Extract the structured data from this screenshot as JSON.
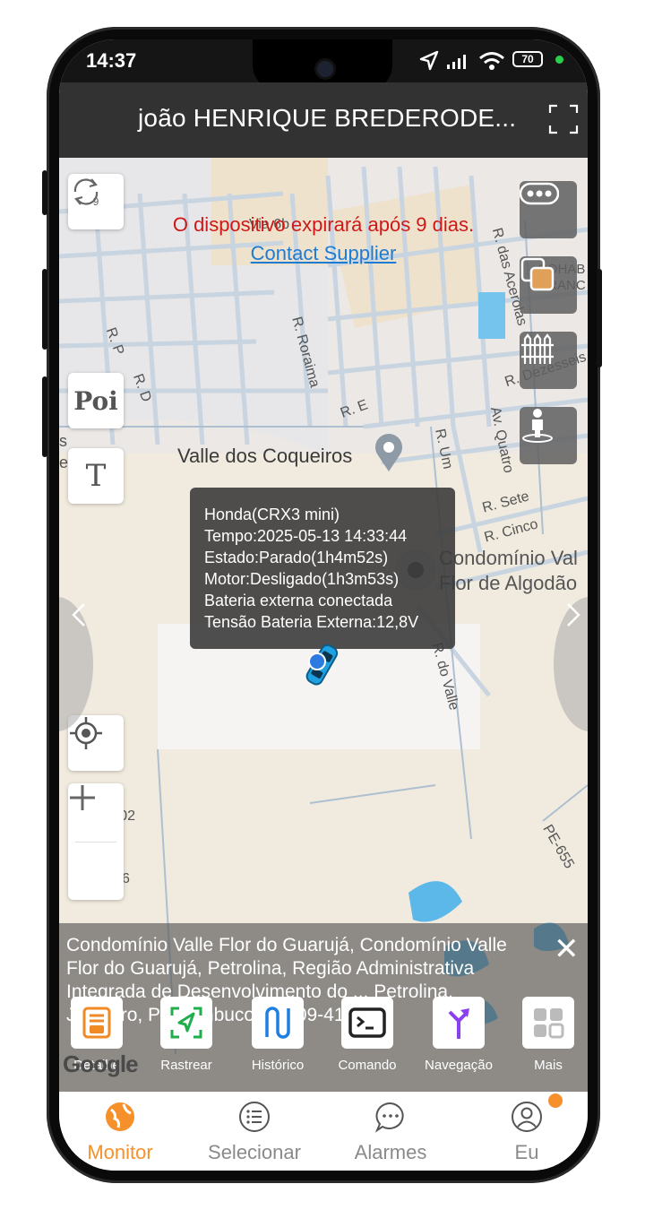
{
  "status_bar": {
    "time": "14:37",
    "battery": "70"
  },
  "app_bar": {
    "title": "joão HENRIQUE BREDERODE..."
  },
  "map": {
    "expiry_notice": "O dispositivo expirará após 9 dias.",
    "contact_link": "Contact Supplier",
    "refresh_count": "9",
    "poi_label": "Poi",
    "text_tool_label": "T",
    "place_labels": {
      "via_6b": "Via 6b",
      "r_p": "R. P",
      "r_d": "R. D",
      "r_roraima": "R. Roraima",
      "r_e": "R. E",
      "r_das_acerolas": "R. das Acerolas",
      "cohab": "COHAB",
      "franc": "FRANC",
      "r_dezesseis": "R. Dezesseis",
      "r_um": "R. Um",
      "av_quatro": "Av. Quatro",
      "r_sete": "R. Sete",
      "r_cinco": "R. Cinco",
      "valle_dos_coqueiros": "Valle dos Coqueiros",
      "condominio_1": "Condomínio Val",
      "condominio_2": "Flor de Algodão",
      "r_do_valle": "R. do Valle",
      "via_02": "Via 02",
      "pe_655": "PE-655",
      "six": "6",
      "s": "s",
      "e": "e"
    }
  },
  "info_window": {
    "lines": [
      "Honda(CRX3 mini)",
      "Tempo:2025-05-13 14:33:44",
      "Estado:Parado(1h4m52s)",
      "Motor:Desligado(1h3m53s)",
      "Bateria externa conectada",
      "Tensão Bateria Externa:12,8V"
    ]
  },
  "address_panel": {
    "text": "Condomínio  Valle Flor do Guarujá, Condomínio Valle Flor do Guarujá, Petrolina, Região Administrativa Integrada de Desenvolvimento do ... Petrolina, Juazeiro, Pernambuco, 56309-41",
    "close": "✕"
  },
  "google_logo": "Google",
  "actions": [
    {
      "label": "Detalhe",
      "color": "#f08a24"
    },
    {
      "label": "Rastrear",
      "color": "#1fae4b"
    },
    {
      "label": "Histórico",
      "color": "#1f7fe0"
    },
    {
      "label": "Comando",
      "color": "#222222"
    },
    {
      "label": "Navegação",
      "color": "#8a3ff0"
    },
    {
      "label": "Mais",
      "color": "#bbbbbb"
    }
  ],
  "tabs": [
    {
      "label": "Monitor",
      "active": true
    },
    {
      "label": "Selecionar"
    },
    {
      "label": "Alarmes"
    },
    {
      "label": "Eu"
    }
  ],
  "colors": {
    "accent": "#f5902a",
    "alert": "#d01818",
    "link": "#1e7bd2"
  }
}
